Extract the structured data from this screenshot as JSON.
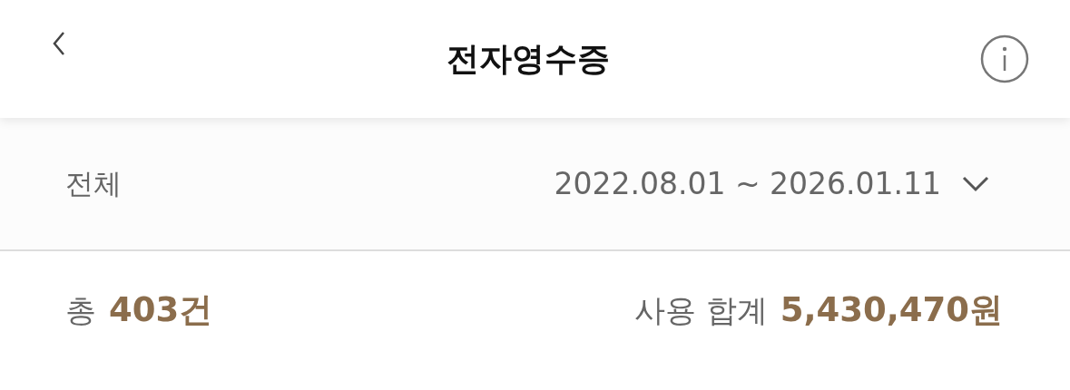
{
  "header": {
    "title": "전자영수증"
  },
  "filter": {
    "label": "전체",
    "date_range": "2022.08.01 ~ 2026.01.11"
  },
  "summary": {
    "total_label": "총",
    "total_count": "403건",
    "sum_label": "사용 합계",
    "sum_value": "5,430,470원"
  }
}
